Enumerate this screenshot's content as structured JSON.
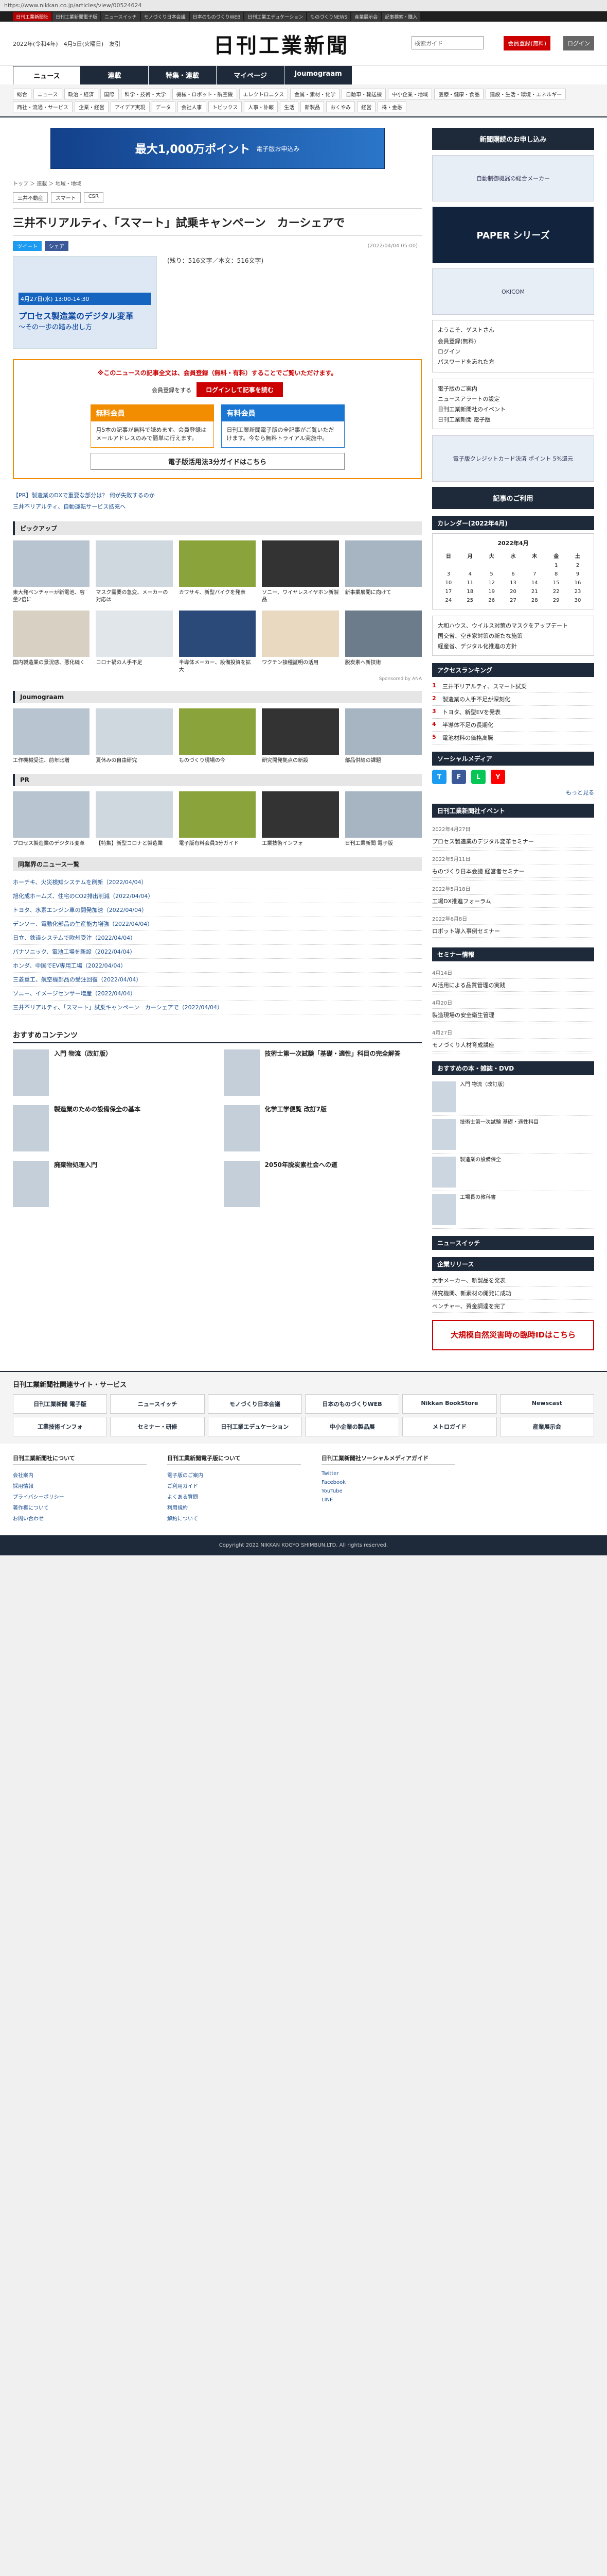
{
  "browser": {
    "url": "https://www.nikkan.co.jp/articles/view/00524624"
  },
  "topstrip": [
    "日刊工業新聞社",
    "日刊工業新聞電子版",
    "ニュースイッチ",
    "モノづくり日本会議",
    "日本のものづくりWEB",
    "日刊工業エデュケーション",
    "ものづくりNEWS",
    "産業展示会",
    "記事検索・購入"
  ],
  "header": {
    "date": "2022年(令和4年)　4月5日(火曜日)　友引",
    "logo": "日刊工業新聞",
    "search_placeholder": "検索ガイド",
    "register_button": "会員登録(無料)",
    "login_button": "ログイン"
  },
  "tabs": [
    "ニュース",
    "連載",
    "特集・連載",
    "マイページ",
    "Joumograam"
  ],
  "subnav": [
    "総合",
    "ニュース",
    "政治・経済",
    "国際",
    "科学・技術・大学",
    "機械・ロボット・航空機",
    "エレクトロニクス",
    "金属・素材・化学",
    "自動車・輸送機",
    "中小企業・地域",
    "医療・健康・食品",
    "建設・生活・環境・エネルギー",
    "商社・流通・サービス",
    "企業・経営",
    "アイデア実現",
    "データ",
    "会社人事",
    "トピックス",
    "人事・訃報",
    "生活",
    "新製品",
    "おくやみ",
    "経営",
    "株・金融"
  ],
  "article": {
    "ad_banner": "最大1,000万ポイント",
    "ad_banner_sub": "電子版お申込み",
    "breadcrumb": "トップ ＞ 連載 ＞ 地域・地域",
    "category_tags": [
      "三井不動産",
      "スマート",
      "CSR"
    ],
    "title": "三井不リアルティ、「スマート」試乗キャンペーン　カーシェアで",
    "share_tw": "ツイート",
    "share_fb": "シェア",
    "published": "(2022/04/04 05:00)",
    "image_tag": "4月27日(水) 13:00-14:30",
    "image_title": "プロセス製造業のデジタル変革",
    "image_subtitle": "～その一歩の踏み出し方",
    "caption": "(残り：516文字／本文：516文字)"
  },
  "paywall": {
    "notice": "※このニュースの記事全文は、会員登録（無料・有料）することでご覧いただけます。",
    "member_label": "会員登録をする",
    "login_label": "ログインして記事を読む",
    "plan_free_title": "無料会員",
    "plan_free_body": "月5本の記事が無料で読めます。会員登録はメールアドレスのみで簡単に行えます。",
    "plan_paid_title": "有料会員",
    "plan_paid_body": "日刊工業新聞電子版の全記事がご覧いただけます。今なら無料トライアル実施中。",
    "bottom_label": "電子版活用法3分ガイドはこちら"
  },
  "related_links": [
    "【PR】製造業のDXで重要な部分は？ 何が失敗するのか",
    "三井不リアルティ、自動運転サービス拡充へ"
  ],
  "pickup": {
    "heading": "ピックアップ",
    "items": [
      "東大発ベンチャーが新電池、容量2倍に",
      "マスク需要の急変、メーカーの対応は",
      "カワサキ、新型バイクを発表",
      "ソニー、ワイヤレスイヤホン新製品",
      "新事業展開に向けて",
      "国内製造業の景況感、悪化続く",
      "コロナ禍の人手不足",
      "半導体メーカー、設備投資を拡大",
      "ワクチン接種証明の活用",
      "脱炭素へ新技術"
    ],
    "sponsored": "Sponsored by ANA"
  },
  "journagram": {
    "heading": "Joumograam",
    "items": [
      "工作機械受注、前年比増",
      "夏休みの自由研究",
      "ものづくり現場の今",
      "研究開発拠点の新設",
      "部品供給の課題"
    ]
  },
  "pr": {
    "heading": "PR",
    "items": [
      "プロセス製造業のデジタル変革",
      "【特集】新型コロナと製造業",
      "電子版有料会員3分ガイド",
      "工業技術インフォ",
      "日刊工業新聞 電子版"
    ]
  },
  "news_list": {
    "heading": "同業界のニュース一覧",
    "items": [
      "ホーチキ、火災検知システムを刷新（2022/04/04）",
      "旭化成ホームズ、住宅のCO2排出削減（2022/04/04）",
      "トヨタ、水素エンジン車の開発加速（2022/04/04）",
      "デンソー、電動化部品の生産能力増強（2022/04/04）",
      "日立、鉄道システムで欧州受注（2022/04/04）",
      "パナソニック、電池工場を新設（2022/04/04）",
      "ホンダ、中国でEV専用工場（2022/04/04）",
      "三菱重工、航空機部品の受注回復（2022/04/04）",
      "ソニー、イメージセンサー増産（2022/04/04）",
      "三井不リアルティ、「スマート」試乗キャンペーン　カーシェアで（2022/04/04）"
    ]
  },
  "recommended": {
    "heading": "おすすめコンテンツ",
    "items": [
      "入門 物流（改訂版）",
      "技術士第一次試験「基礎・適性」科目の完全解答",
      "製造業のための設備保全の基本",
      "化学工学便覧 改訂7版",
      "廃棄物処理入門",
      "2050年脱炭素社会への道"
    ]
  },
  "sidebar": {
    "subscribe_button": "新聞購読のお申し込み",
    "ad1": "自動制御機器の総合メーカー",
    "ad2": "PAPER シリーズ",
    "ad3": "OKICOM",
    "welcome": "ようこそ、ゲストさん",
    "welcome_links": [
      "会員登録(無料)",
      "ログイン",
      "パスワードを忘れた方"
    ],
    "service_links": [
      "電子版のご案内",
      "ニュースアラートの設定",
      "日刊工業新聞社のイベント",
      "日刊工業新聞 電子版"
    ],
    "ad4": "電子版クレジットカード決済 ポイント 5%還元",
    "manual": "記事のご利用",
    "calendar_heading": "カレンダー(2022年4月)",
    "calendar_month": "2022年4月",
    "calendar_days": [
      "日",
      "月",
      "火",
      "水",
      "木",
      "金",
      "土"
    ],
    "calendar_weeks": [
      [
        "",
        "",
        "",
        "",
        "",
        "1",
        "2"
      ],
      [
        "3",
        "4",
        "5",
        "6",
        "7",
        "8",
        "9"
      ],
      [
        "10",
        "11",
        "12",
        "13",
        "14",
        "15",
        "16"
      ],
      [
        "17",
        "18",
        "19",
        "20",
        "21",
        "22",
        "23"
      ],
      [
        "24",
        "25",
        "26",
        "27",
        "28",
        "29",
        "30"
      ]
    ],
    "picks": [
      "大和ハウス、ウイルス対策のマスクをアップデート",
      "国交省、空き家対策の新たな施策",
      "経産省、デジタル化推進の方針"
    ],
    "ranking_heading": "アクセスランキング",
    "ranking": [
      "三井不リアルティ、スマート試乗",
      "製造業の人手不足が深刻化",
      "トヨタ、新型EVを発表",
      "半導体不足の長期化",
      "電池材料の価格高騰"
    ],
    "social_heading": "ソーシャルメディア",
    "social_icons": [
      "Twitter",
      "Facebook",
      "LINE",
      "YouTube"
    ],
    "social_more": "もっと見る",
    "event_heading": "日刊工業新聞社イベント",
    "events": [
      {
        "date": "2022年4月27日",
        "title": "プロセス製造業のデジタル変革セミナー"
      },
      {
        "date": "2022年5月11日",
        "title": "ものづくり日本会議 経営者セミナー"
      },
      {
        "date": "2022年5月18日",
        "title": "工場DX推進フォーラム"
      },
      {
        "date": "2022年6月8日",
        "title": "ロボット導入事例セミナー"
      }
    ],
    "seminar_heading": "セミナー情報",
    "seminars": [
      {
        "date": "4月14日",
        "title": "AI活用による品質管理の実践"
      },
      {
        "date": "4月20日",
        "title": "製造現場の安全衛生管理"
      },
      {
        "date": "4月27日",
        "title": "モノづくり人材育成講座"
      }
    ],
    "books_heading": "おすすめの本・雑誌・DVD",
    "books": [
      "入門 物流（改訂版）",
      "技術士第一次試験 基礎・適性科目",
      "製造業の設備保全",
      "工場長の教科書"
    ],
    "news_heading": "ニュースイッチ",
    "pr_heading": "企業リリース",
    "pr_items": [
      "大手メーカー、新製品を発表",
      "研究機関、新素材の開発に成功",
      "ベンチャー、資金調達を完了"
    ],
    "disaster_notice": "大規模自然災害時の臨時IDはこちら"
  },
  "footer": {
    "sites_heading": "日刊工業新聞社関連サイト・サービス",
    "sites": [
      "日刊工業新聞 電子版",
      "ニュースイッチ",
      "モノづくり日本会議",
      "日本のものづくりWEB",
      "Nikkan BookStore",
      "Newscast",
      "工業技術インフォ",
      "セミナー・研修",
      "日刊工業エデュケーション",
      "中小企業の製品展",
      "メトロガイド",
      "産業展示会"
    ],
    "col1_heading": "日刊工業新聞社について",
    "col1": [
      "会社案内",
      "採用情報",
      "プライバシーポリシー",
      "著作権について",
      "お問い合わせ"
    ],
    "col2_heading": "日刊工業新聞電子版について",
    "col2": [
      "電子版のご案内",
      "ご利用ガイド",
      "よくある質問",
      "利用規約",
      "解約について"
    ],
    "col3_heading": "日刊工業新聞社ソーシャルメディアガイド",
    "col3": [
      "Twitter",
      "Facebook",
      "YouTube",
      "LINE"
    ],
    "copyright": "Copyright 2022 NIKKAN KOGYO SHIMBUN,LTD. All rights reserved."
  }
}
